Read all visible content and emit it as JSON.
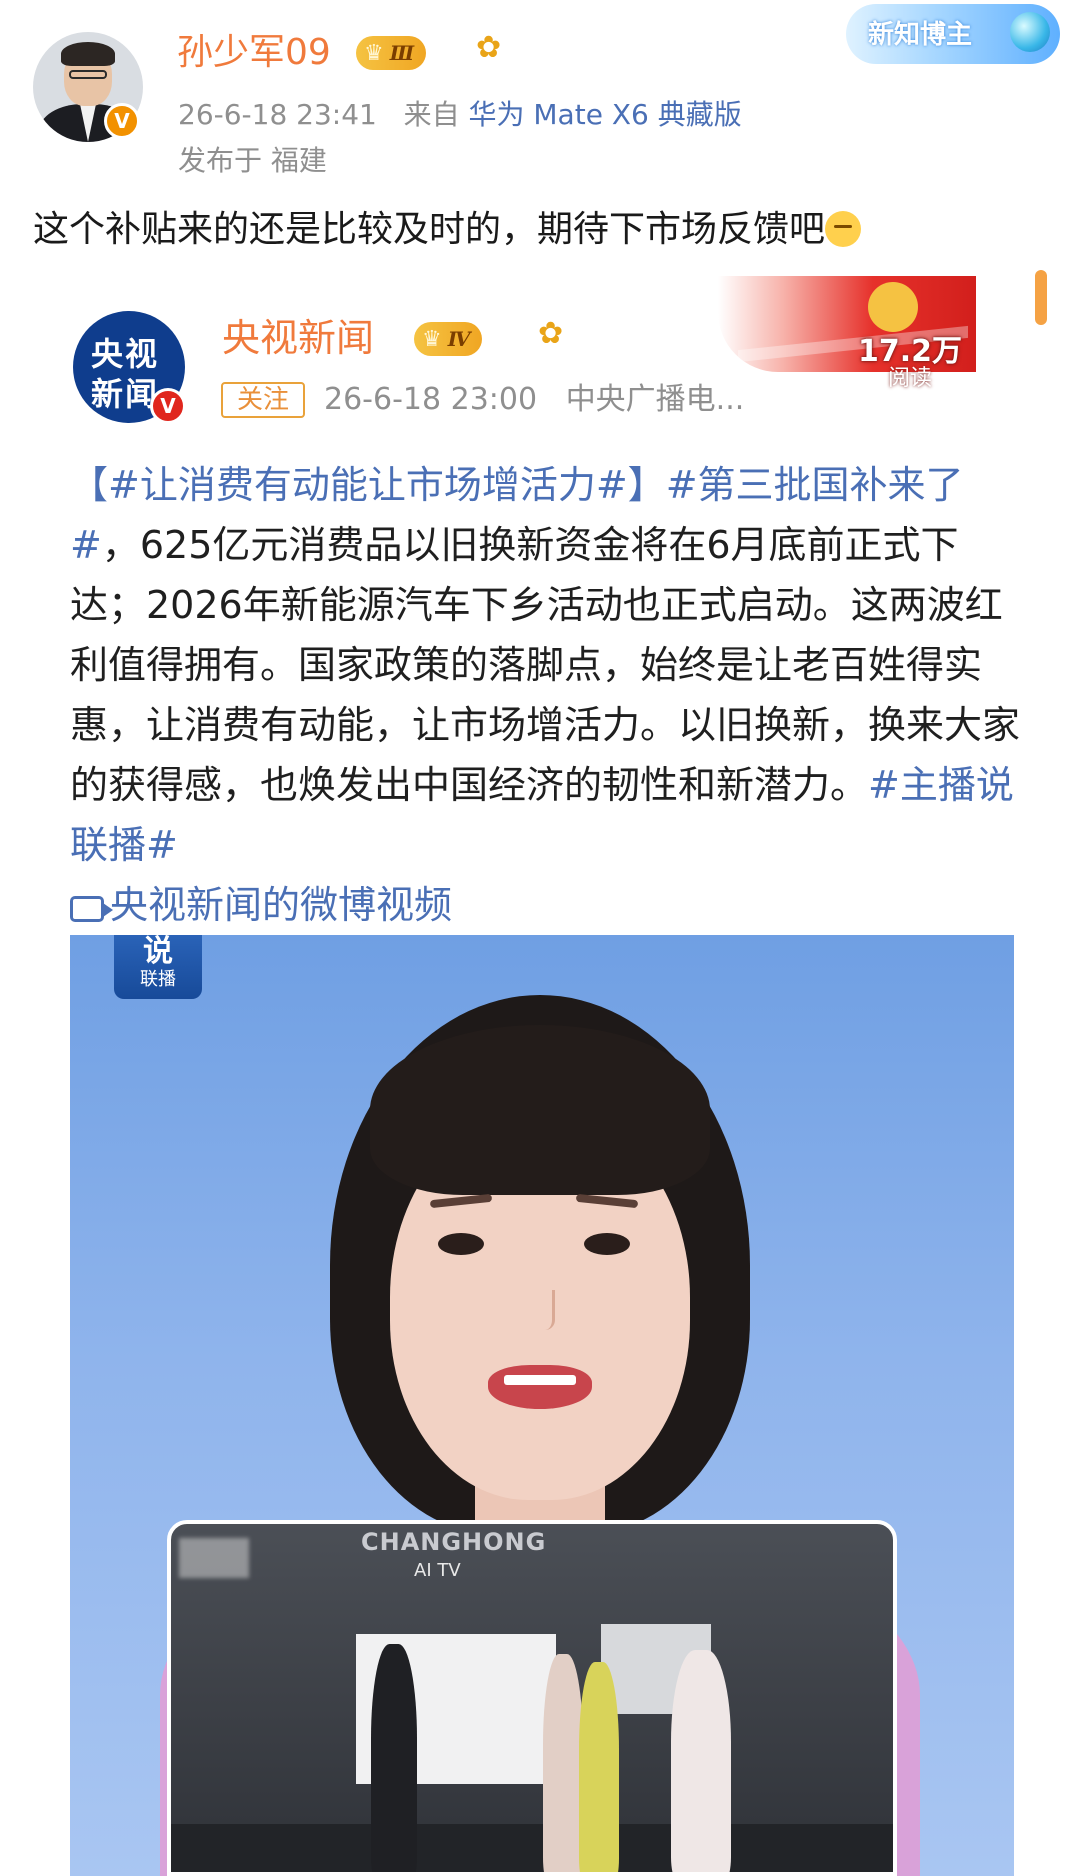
{
  "post": {
    "username": "孙少军09",
    "user_rank": "Ⅲ",
    "verified_mark": "V",
    "badge_label": "新知博主",
    "timestamp": "26-6-18 23:41",
    "source_prefix": "来自",
    "device": "华为 Mate X6 典藏版",
    "location_prefix": "发布于",
    "location": "福建",
    "text": "这个补贴来的还是比较及时的，期待下市场反馈吧"
  },
  "repost": {
    "account_name": "央视新闻",
    "account_rank": "Ⅳ",
    "verified_mark": "V",
    "logo_line1": "央视",
    "logo_line2": "新闻",
    "follow_label": "关注",
    "timestamp": "26-6-18 23:00",
    "source": "中央广播电...",
    "read_count": "17.2万",
    "read_label": "阅读",
    "tag1": "【#让消费有动能让市场增活力#】",
    "tag2": "#第三批国补来了#",
    "body": "，625亿元消费品以旧换新资金将在6月底前正式下达；2026年新能源汽车下乡活动也正式启动。这两波红利值得拥有。国家政策的落脚点，始终是让老百姓得实惠，让消费有动能，让市场增活力。以旧换新，换来大家的获得感，也焕发出中国经济的韧性和新潜力。",
    "tag3": "#主播说联播#",
    "video_link": "央视新闻的微博视频"
  },
  "video": {
    "show_logo_top": "说",
    "show_logo_bottom": "联播",
    "inset_brand": "CHANGHONG",
    "inset_sub": "AI TV"
  },
  "icons": [
    "crown-icon",
    "sunflower-icon",
    "video-icon",
    "globe-icon"
  ],
  "colors": {
    "username": "#f07a3c",
    "link": "#4a6fb5",
    "verified_orange": "#f29100",
    "verified_red": "#e0261d",
    "cctv_blue": "#0f3d8d"
  }
}
